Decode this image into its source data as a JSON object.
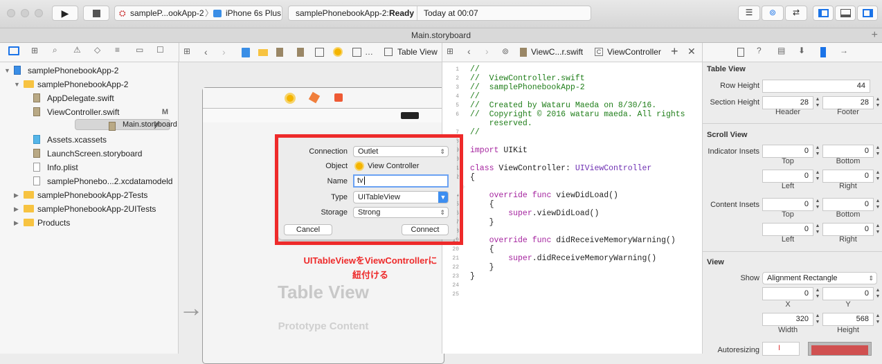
{
  "toolbar": {
    "scheme": "sampleP...ookApp-2",
    "device": "iPhone 6s Plus",
    "status_project": "samplePhonebookApp-2:",
    "status_state": "Ready",
    "status_time": "Today at 00:07"
  },
  "tab": {
    "title": "Main.storyboard"
  },
  "navigator": {
    "items": [
      {
        "label": "samplePhonebookApp-2",
        "kind": "project",
        "indent": 0,
        "tri": "▼"
      },
      {
        "label": "samplePhonebookApp-2",
        "kind": "folder",
        "indent": 1,
        "tri": "▼"
      },
      {
        "label": "AppDelegate.swift",
        "kind": "swift",
        "indent": 2
      },
      {
        "label": "ViewController.swift",
        "kind": "swift",
        "indent": 2,
        "badge": "M"
      },
      {
        "label": "Main.storyboard",
        "kind": "storyboard",
        "indent": 2,
        "badge": "M",
        "selected": true
      },
      {
        "label": "Assets.xcassets",
        "kind": "assets",
        "indent": 2
      },
      {
        "label": "LaunchScreen.storyboard",
        "kind": "storyboard",
        "indent": 2
      },
      {
        "label": "Info.plist",
        "kind": "plist",
        "indent": 2
      },
      {
        "label": "samplePhonebo...2.xcdatamodeld",
        "kind": "data",
        "indent": 2
      },
      {
        "label": "samplePhonebookApp-2Tests",
        "kind": "folder",
        "indent": 1,
        "tri": "▶"
      },
      {
        "label": "samplePhonebookApp-2UITests",
        "kind": "folder",
        "indent": 1,
        "tri": "▶"
      },
      {
        "label": "Products",
        "kind": "folder",
        "indent": 1,
        "tri": "▶"
      }
    ]
  },
  "canvas": {
    "jump_last": "Table View",
    "placeholder_title": "Table View",
    "placeholder_sub": "Prototype Content"
  },
  "editor": {
    "jump_file": "ViewC...r.swift",
    "jump_symbol": "ViewController",
    "code": [
      {
        "n": "1",
        "t": "//",
        "c": "cm"
      },
      {
        "n": "2",
        "t": "//  ViewController.swift",
        "c": "cm"
      },
      {
        "n": "3",
        "t": "//  samplePhonebookApp-2",
        "c": "cm"
      },
      {
        "n": "4",
        "t": "//",
        "c": "cm"
      },
      {
        "n": "5",
        "t": "//  Created by Wataru Maeda on 8/30/16.",
        "c": "cm"
      },
      {
        "n": "6",
        "t": "//  Copyright © 2016 wataru maeda. All rights",
        "c": "cm"
      },
      {
        "n": "",
        "t": "    reserved.",
        "c": "cm"
      },
      {
        "n": "7",
        "t": "//",
        "c": "cm"
      },
      {
        "n": "8",
        "t": "",
        "c": ""
      },
      {
        "n": "9",
        "t": "import UIKit",
        "c": ""
      },
      {
        "n": "10",
        "t": "",
        "c": ""
      },
      {
        "n": "11",
        "t": "class ViewController: UIViewController",
        "c": ""
      },
      {
        "n": "12",
        "t": "{",
        "c": ""
      },
      {
        "n": "13",
        "t": "",
        "c": ""
      },
      {
        "n": "14",
        "t": "    override func viewDidLoad()",
        "c": ""
      },
      {
        "n": "15",
        "t": "    {",
        "c": ""
      },
      {
        "n": "16",
        "t": "        super.viewDidLoad()",
        "c": ""
      },
      {
        "n": "17",
        "t": "    }",
        "c": ""
      },
      {
        "n": "18",
        "t": "",
        "c": ""
      },
      {
        "n": "19",
        "t": "    override func didReceiveMemoryWarning()",
        "c": ""
      },
      {
        "n": "20",
        "t": "    {",
        "c": ""
      },
      {
        "n": "21",
        "t": "        super.didReceiveMemoryWarning()",
        "c": ""
      },
      {
        "n": "22",
        "t": "    }",
        "c": ""
      },
      {
        "n": "23",
        "t": "}",
        "c": ""
      },
      {
        "n": "24",
        "t": "",
        "c": ""
      },
      {
        "n": "25",
        "t": "",
        "c": ""
      }
    ]
  },
  "popup": {
    "connection_label": "Connection",
    "connection_value": "Outlet",
    "object_label": "Object",
    "object_value": "View Controller",
    "name_label": "Name",
    "name_value": "tv",
    "type_label": "Type",
    "type_value": "UITableView",
    "storage_label": "Storage",
    "storage_value": "Strong",
    "cancel": "Cancel",
    "connect": "Connect"
  },
  "annotation": {
    "line1": "UITableViewをViewControllerに",
    "line2": "紐付ける"
  },
  "inspector": {
    "table_view": "Table View",
    "row_height_label": "Row Height",
    "row_height": "44",
    "section_height_label": "Section Height",
    "header_value": "28",
    "footer_value": "28",
    "header": "Header",
    "footer": "Footer",
    "scroll_view": "Scroll View",
    "indicator_insets": "Indicator Insets",
    "content_insets": "Content Insets",
    "top": "Top",
    "bottom": "Bottom",
    "left": "Left",
    "right": "Right",
    "zero": "0",
    "view": "View",
    "show_label": "Show",
    "show_value": "Alignment Rectangle",
    "x_value": "0",
    "y_value": "0",
    "x": "X",
    "y": "Y",
    "width_value": "320",
    "height_value": "568",
    "width": "Width",
    "height": "Height",
    "autoresizing": "Autoresizing"
  },
  "colors": {
    "accent": "#1a73e8",
    "annotation": "#ee2a2a",
    "comment": "#1e7d18",
    "keyword": "#a5249f"
  }
}
